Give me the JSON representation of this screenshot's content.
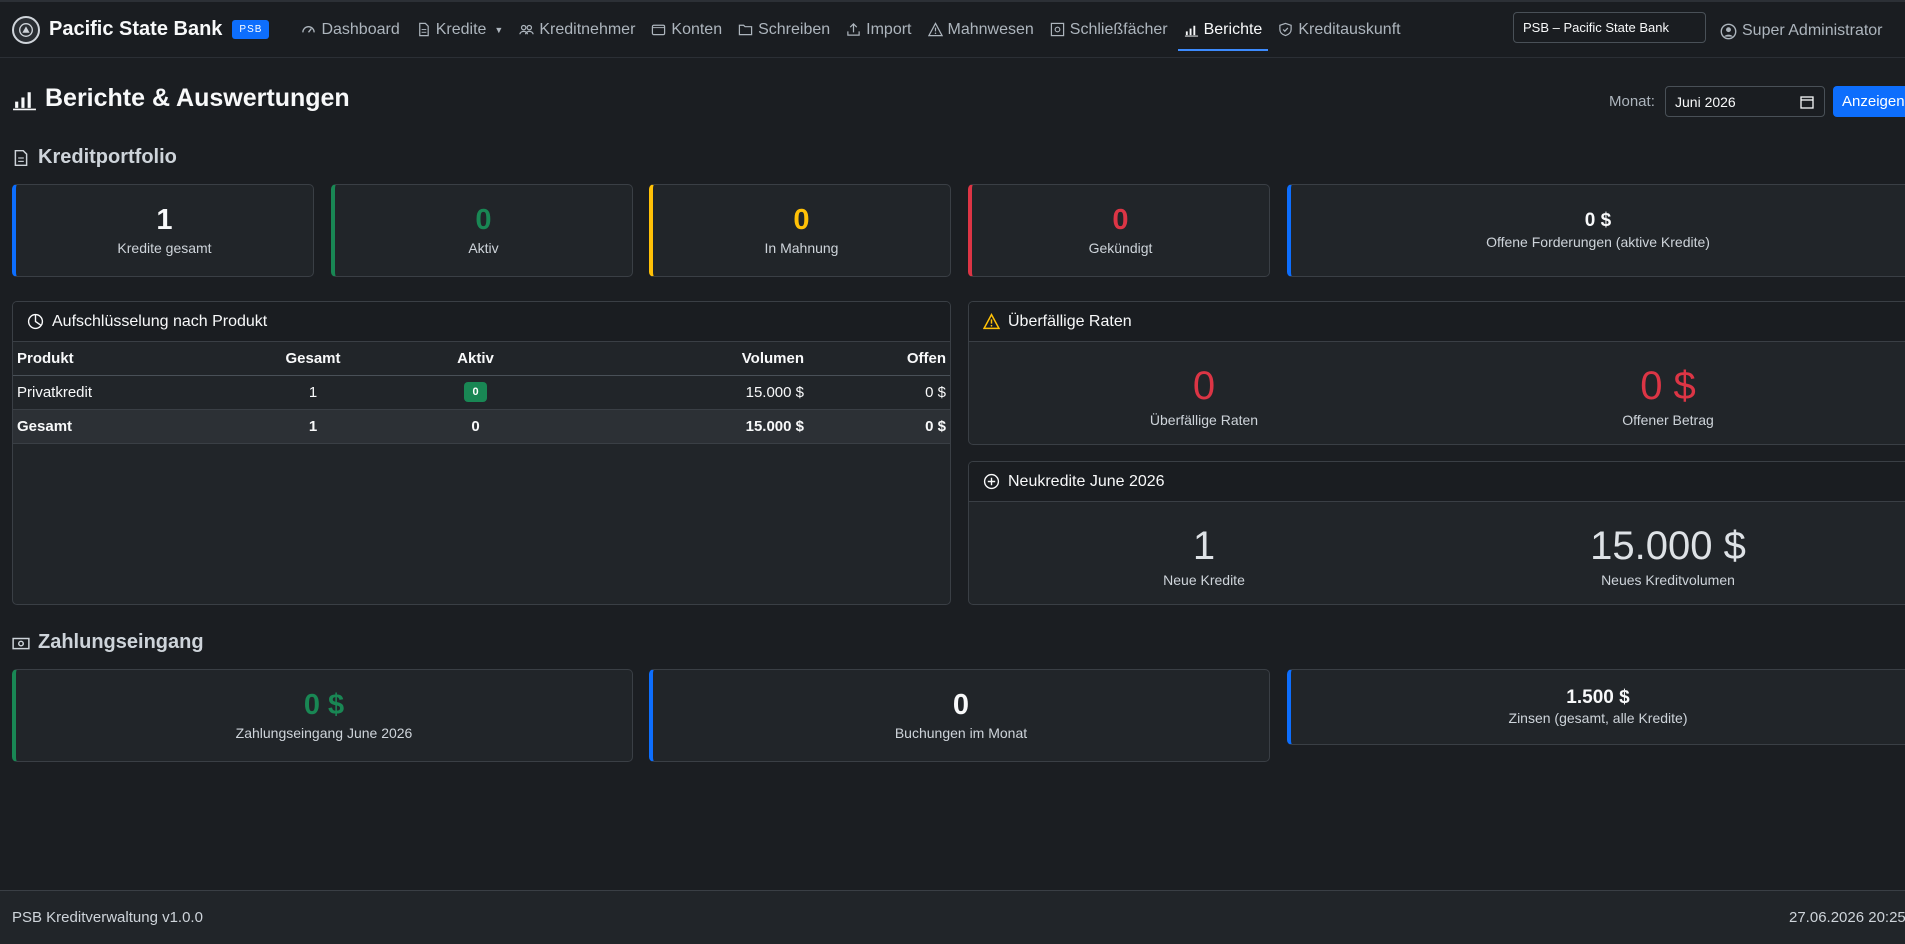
{
  "brand": {
    "name": "Pacific State Bank",
    "badge": "PSB"
  },
  "nav": {
    "items": [
      {
        "label": "Dashboard",
        "icon": "speedometer-icon"
      },
      {
        "label": "Kredite",
        "icon": "document-icon",
        "dropdown": true
      },
      {
        "label": "Kreditnehmer",
        "icon": "people-icon"
      },
      {
        "label": "Konten",
        "icon": "wallet-icon"
      },
      {
        "label": "Schreiben",
        "icon": "folder-icon"
      },
      {
        "label": "Import",
        "icon": "upload-icon"
      },
      {
        "label": "Mahnwesen",
        "icon": "warning-icon"
      },
      {
        "label": "Schließfächer",
        "icon": "safe-icon"
      },
      {
        "label": "Berichte",
        "icon": "bar-chart-icon",
        "active": true
      },
      {
        "label": "Kreditauskunft",
        "icon": "shield-icon"
      }
    ],
    "bank_select": "PSB – Pacific State Bank",
    "user": "Super Administrator"
  },
  "page": {
    "title": "Berichte & Auswertungen",
    "month_label": "Monat:",
    "month_value": "Juni 2026",
    "show_button": "Anzeigen"
  },
  "portfolio": {
    "title": "Kreditportfolio",
    "cards": [
      {
        "value": "1",
        "label": "Kredite gesamt",
        "color": "#f8f9fa",
        "border": "#0d6efd"
      },
      {
        "value": "0",
        "label": "Aktiv",
        "color": "#198754",
        "border": "#198754"
      },
      {
        "value": "0",
        "label": "In Mahnung",
        "color": "#ffc107",
        "border": "#ffc107"
      },
      {
        "value": "0",
        "label": "Gekündigt",
        "color": "#dc3545",
        "border": "#dc3545"
      },
      {
        "value": "0 $",
        "label": "Offene Forderungen (aktive Kredite)",
        "color": "#f8f9fa",
        "border": "#0d6efd"
      }
    ]
  },
  "breakdown": {
    "title": "Aufschlüsselung nach Produkt",
    "headers": [
      "Produkt",
      "Gesamt",
      "Aktiv",
      "Volumen",
      "Offen"
    ],
    "rows": [
      {
        "product": "Privatkredit",
        "total": "1",
        "active": "0",
        "volume": "15.000 $",
        "open": "0 $"
      }
    ],
    "total_row": {
      "product": "Gesamt",
      "total": "1",
      "active": "0",
      "volume": "15.000 $",
      "open": "0 $"
    }
  },
  "overdue": {
    "title": "Überfällige Raten",
    "count": "0",
    "count_label": "Überfällige Raten",
    "amount": "0 $",
    "amount_label": "Offener Betrag",
    "color": "#dc3545"
  },
  "new_loans": {
    "title": "Neukredite June 2026",
    "count": "1",
    "count_label": "Neue Kredite",
    "volume": "15.000 $",
    "volume_label": "Neues Kreditvolumen"
  },
  "payments": {
    "title": "Zahlungseingang",
    "cards": [
      {
        "value": "0 $",
        "label": "Zahlungseingang June 2026",
        "color": "#198754",
        "border": "#198754"
      },
      {
        "value": "0",
        "label": "Buchungen im Monat",
        "color": "#f8f9fa",
        "border": "#0d6efd"
      },
      {
        "value": "1.500 $",
        "label": "Zinsen (gesamt, alle Kredite)",
        "color": "#f8f9fa",
        "border": "#0d6efd"
      }
    ]
  },
  "footer": {
    "left": "PSB Kreditverwaltung v1.0.0",
    "right": "27.06.2026 20:25"
  }
}
